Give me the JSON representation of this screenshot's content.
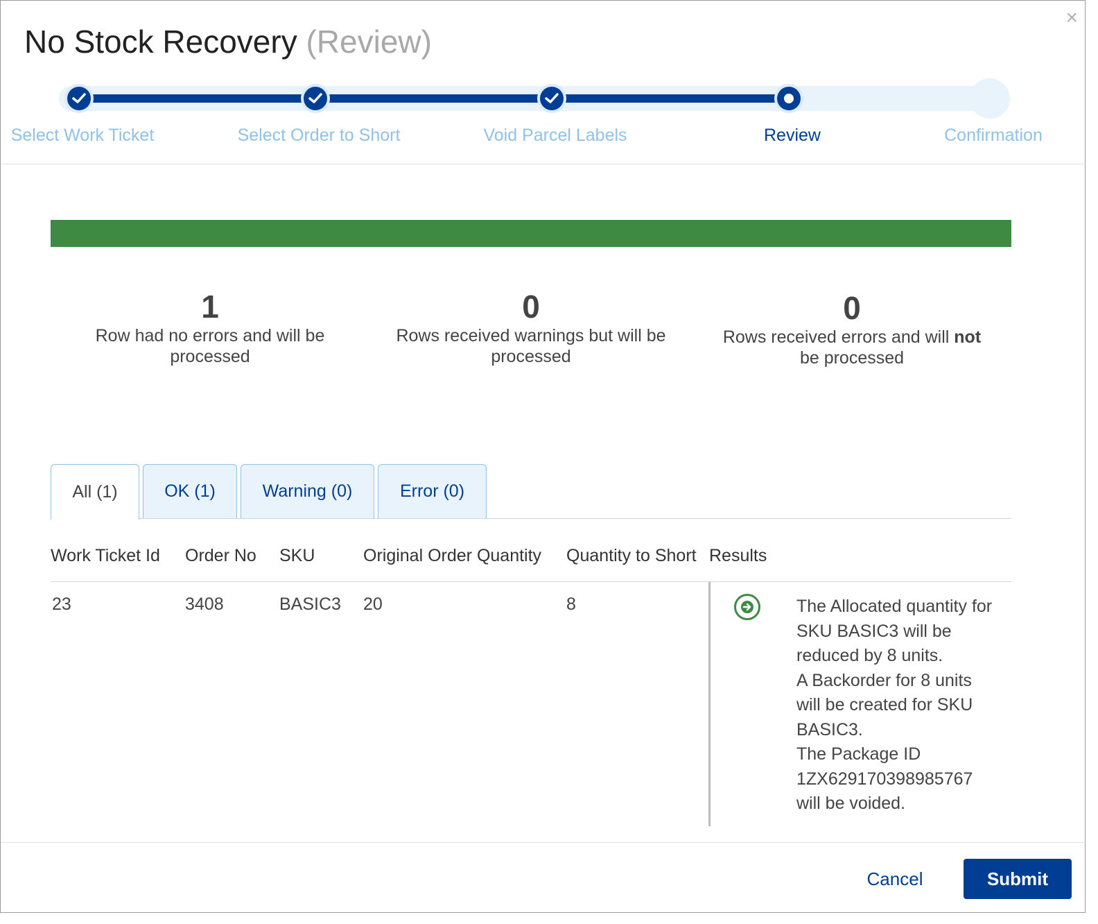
{
  "dialog": {
    "title": "No Stock Recovery",
    "subtitle": "(Review)",
    "close_symbol": "×"
  },
  "stepper": {
    "steps": [
      {
        "label": "Select Work Ticket",
        "state": "complete"
      },
      {
        "label": "Select Order to Short",
        "state": "complete"
      },
      {
        "label": "Void Parcel Labels",
        "state": "complete"
      },
      {
        "label": "Review",
        "state": "current"
      },
      {
        "label": "Confirmation",
        "state": "future"
      }
    ]
  },
  "progress": {
    "percent": 100,
    "color": "#3e8a43"
  },
  "stats": [
    {
      "count": "1",
      "text": "Row had no errors and will be processed"
    },
    {
      "count": "0",
      "text": "Rows received warnings but will be processed"
    },
    {
      "count": "0",
      "text_before": "Rows received errors and will ",
      "text_bold": "not",
      "text_after": " be processed"
    }
  ],
  "tabs": [
    {
      "label": "All (1)",
      "active": true
    },
    {
      "label": "OK (1)",
      "active": false
    },
    {
      "label": "Warning (0)",
      "active": false
    },
    {
      "label": "Error (0)",
      "active": false
    }
  ],
  "table": {
    "columns": [
      "Work Ticket Id",
      "Order No",
      "SKU",
      "Original Order Quantity",
      "Quantity to Short",
      "Results"
    ],
    "rows": [
      {
        "work_ticket_id": "23",
        "order_no": "3408",
        "sku": "BASIC3",
        "original_order_quantity": "20",
        "quantity_to_short": "8",
        "result_icon": "arrow-right-circle-icon",
        "result_lines": [
          "The Allocated quantity for",
          "SKU BASIC3 will be",
          "reduced by 8 units.",
          "A Backorder for 8 units",
          "will be created for SKU",
          "BASIC3.",
          "The Package ID",
          "1ZX629170398985767",
          "will be voided."
        ]
      }
    ]
  },
  "footer": {
    "cancel_label": "Cancel",
    "submit_label": "Submit"
  },
  "colors": {
    "primary": "#003e94",
    "step_inactive": "#8fc2e6",
    "success": "#3e8a43"
  }
}
